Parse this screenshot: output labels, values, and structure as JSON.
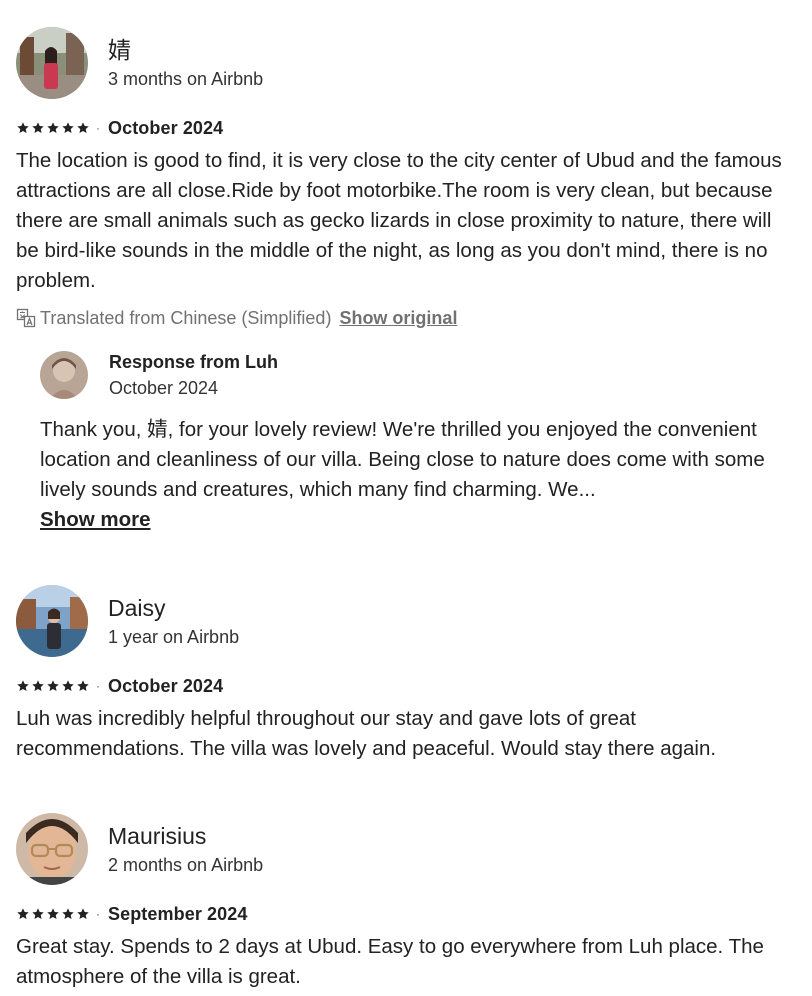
{
  "reviews": [
    {
      "name": "婧",
      "tenure": "3 months on Airbnb",
      "rating": 5,
      "date": "October 2024",
      "text": "The location is good to find, it is very close to the city center of Ubud and the famous attractions are all close.Ride by foot motorbike.The room is very clean, but because there are small animals such as gecko lizards in close proximity to nature, there will be bird-like sounds in the middle of the night, as long as you don't mind, there is no problem.",
      "translation_note": "Translated from Chinese (Simplified)",
      "show_original_label": "Show original",
      "response": {
        "title": "Response from Luh",
        "date": "October 2024",
        "text": "Thank you, 婧, for your lovely review! We're thrilled you enjoyed the convenient location and cleanliness of our villa. Being close to nature does come with some lively sounds and creatures, which many find charming. We...",
        "show_more_label": "Show more"
      }
    },
    {
      "name": "Daisy",
      "tenure": "1 year on Airbnb",
      "rating": 5,
      "date": "October 2024",
      "text": "Luh was incredibly helpful throughout our stay and gave lots of great recommendations. The villa was lovely and peaceful. Would stay there again."
    },
    {
      "name": "Maurisius",
      "tenure": "2 months on Airbnb",
      "rating": 5,
      "date": "September 2024",
      "text": "Great stay. Spends to 2 days at Ubud. Easy to go everywhere from Luh place. The atmosphere of the villa is great."
    }
  ],
  "separator": "·",
  "icons": {
    "star": "star-icon",
    "translate": "translate-icon"
  },
  "colors": {
    "text": "#222222",
    "muted": "#717171"
  }
}
